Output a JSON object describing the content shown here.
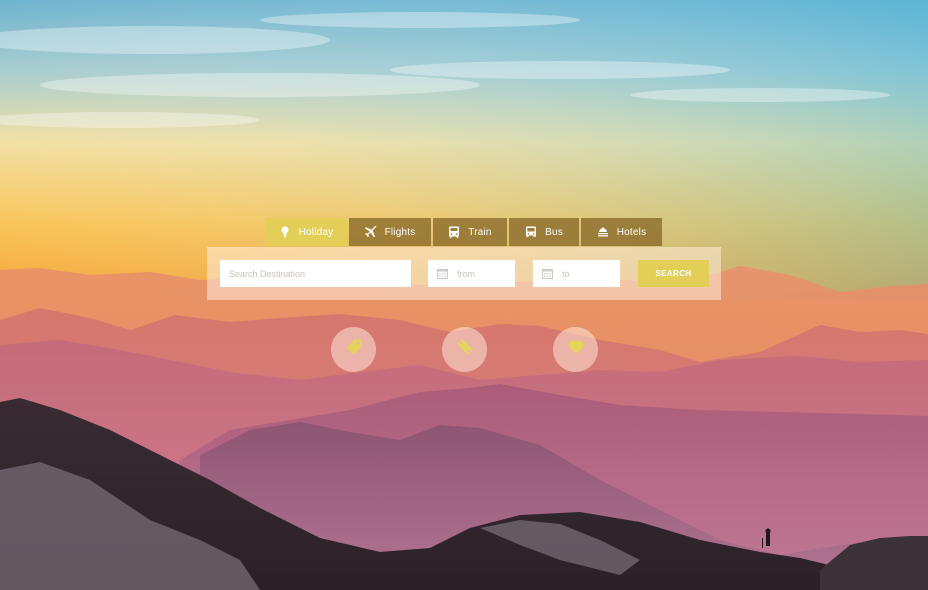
{
  "tabs": [
    {
      "label": "Holiday",
      "icon": "pin-icon",
      "active": true
    },
    {
      "label": "Flights",
      "icon": "plane-icon",
      "active": false
    },
    {
      "label": "Train",
      "icon": "train-icon",
      "active": false
    },
    {
      "label": "Bus",
      "icon": "bus-icon",
      "active": false
    },
    {
      "label": "Hotels",
      "icon": "bed-icon",
      "active": false
    }
  ],
  "search": {
    "destination_placeholder": "Search Destination",
    "from_placeholder": "from",
    "to_placeholder": "to",
    "button_label": "SEARCH"
  },
  "quick_actions": [
    {
      "icon": "tag-icon"
    },
    {
      "icon": "ticket-icon"
    },
    {
      "icon": "heart-icon"
    }
  ],
  "colors": {
    "accent": "#e3cf58",
    "tab_background": "#8c6e2d",
    "sky_top": "#5ab8d8",
    "sky_bottom": "#f6b23a"
  }
}
